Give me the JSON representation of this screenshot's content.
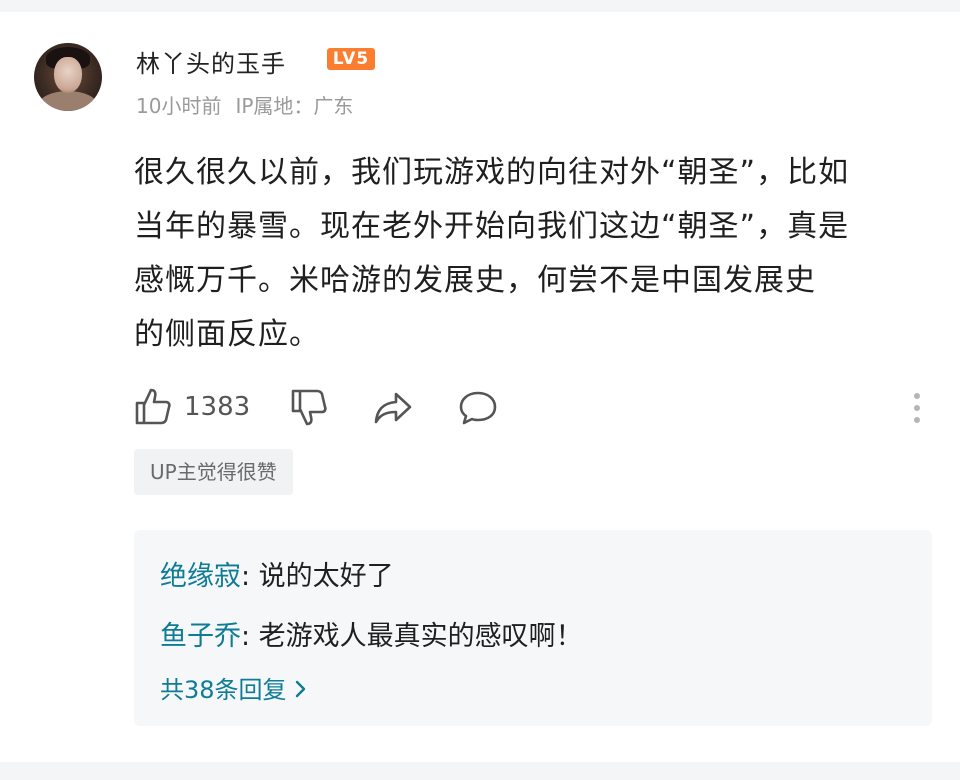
{
  "comment": {
    "username": "林丫头的玉手",
    "level_badge": "LV5",
    "time": "10小时前",
    "ip_location": "IP属地：广东",
    "text_lines": [
      "很久很久以前，我们玩游戏的向往对外“朝圣”，比如",
      "当年的暴雪。现在老外开始向我们这边“朝圣”，真是",
      "感慨万千。米哈游的发展史，何尝不是中国发展史",
      "的侧面反应。"
    ],
    "actions": {
      "like_icon": "thumbs-up-icon",
      "like_count": "1383",
      "dislike_icon": "thumbs-down-icon",
      "share_icon": "share-icon",
      "reply_icon": "comment-bubble-icon",
      "more_icon": "more-vertical-icon"
    },
    "up_liked_tag": "UP主觉得很赞"
  },
  "replies": {
    "items": [
      {
        "name": "绝缘寂",
        "text": ": 说的太好了"
      },
      {
        "name": "鱼子乔",
        "text": ": 老游戏人最真实的感叹啊！"
      }
    ],
    "more_label": "共38条回复",
    "more_icon": "chevron-right-icon"
  },
  "colors": {
    "accent": "#0e7c96",
    "level_badge": "#fb7d2f",
    "muted_text": "#9a9a9a",
    "reply_bg": "#f6f7f9"
  }
}
